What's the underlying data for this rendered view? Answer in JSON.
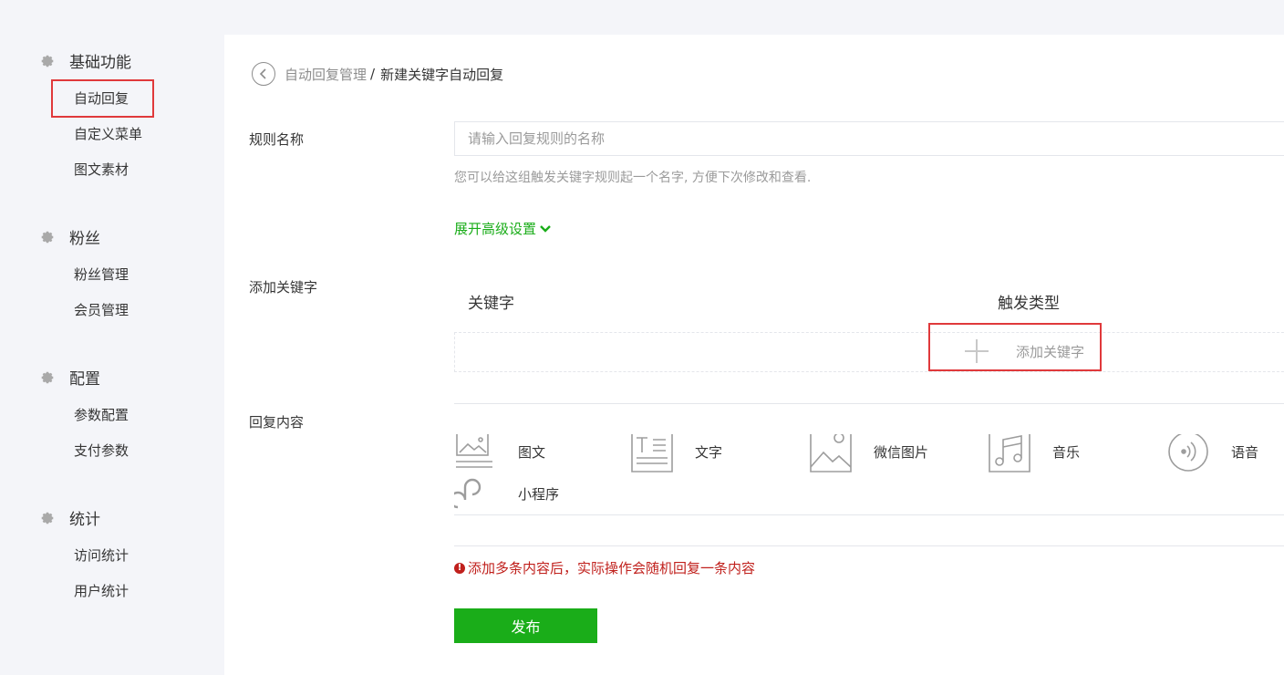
{
  "sidebar": {
    "groups": [
      {
        "title": "基础功能",
        "items": [
          "自动回复",
          "自定义菜单",
          "图文素材"
        ]
      },
      {
        "title": "粉丝",
        "items": [
          "粉丝管理",
          "会员管理"
        ]
      },
      {
        "title": "配置",
        "items": [
          "参数配置",
          "支付参数"
        ]
      },
      {
        "title": "统计",
        "items": [
          "访问统计",
          "用户统计"
        ]
      }
    ],
    "active_item": "自动回复"
  },
  "breadcrumb": {
    "parent": "自动回复管理",
    "separator": "/",
    "current": "新建关键字自动回复"
  },
  "form": {
    "rule_name_label": "规则名称",
    "rule_name_placeholder": "请输入回复规则的名称",
    "rule_name_value": "",
    "rule_name_hint": "您可以给这组触发关键字规则起一个名字, 方便下次修改和查看.",
    "advanced_toggle": "展开高级设置",
    "add_keyword_label": "添加关键字",
    "keyword_table": {
      "col_keyword": "关键字",
      "col_trigger_type": "触发类型"
    },
    "add_keyword_button": "添加关键字",
    "reply_content_label": "回复内容",
    "reply_types": [
      "图文",
      "文字",
      "微信图片",
      "音乐",
      "语音",
      "小程序"
    ],
    "warning": "添加多条内容后，实际操作会随机回复一条内容",
    "publish_button": "发布"
  },
  "colors": {
    "accent": "#1aad19",
    "warning": "#c0201c",
    "highlight": "#e0393b"
  }
}
